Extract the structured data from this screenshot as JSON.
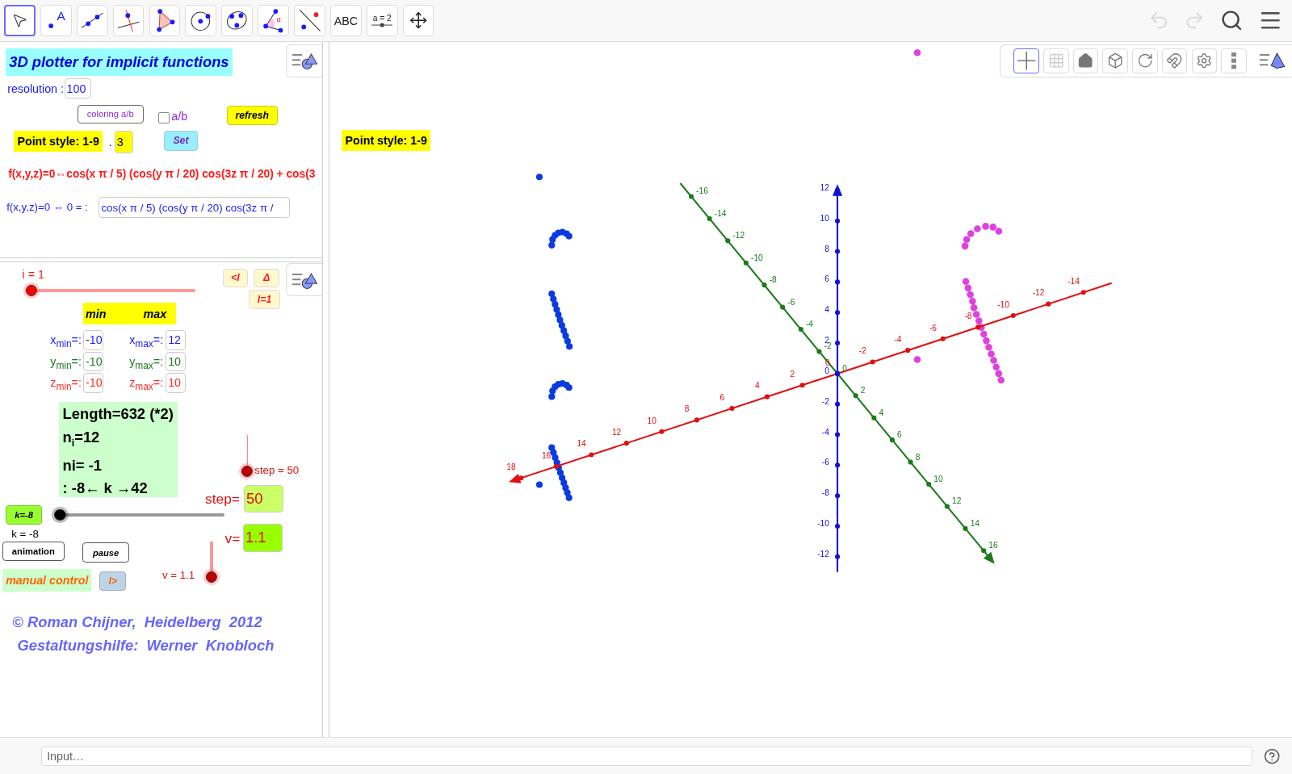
{
  "toolbar": {
    "tools": [
      {
        "kind": "move",
        "selected": true
      },
      {
        "kind": "point",
        "label": "A",
        "selected": false
      },
      {
        "kind": "line",
        "selected": false
      },
      {
        "kind": "perpendicular",
        "selected": false
      },
      {
        "kind": "polygon",
        "selected": false
      },
      {
        "kind": "circle",
        "selected": false
      },
      {
        "kind": "conic",
        "selected": false
      },
      {
        "kind": "angle",
        "label": "α",
        "selected": false
      },
      {
        "kind": "reflect",
        "selected": false
      },
      {
        "kind": "text",
        "label": "ABC",
        "selected": false
      },
      {
        "kind": "slider",
        "label": "a = 2",
        "selected": false
      },
      {
        "kind": "pan",
        "selected": false
      }
    ],
    "undo": {
      "disabled": true
    },
    "redo": {
      "disabled": true
    }
  },
  "algebra": {
    "title": "3D plotter for implicit functions",
    "resolution": {
      "label": "resolution :",
      "value": "100"
    },
    "coloring_button": "coloring a/b",
    "checkbox": {
      "label": "a/b",
      "checked": false
    },
    "refresh_button": "refresh",
    "point_style": {
      "label": "Point style: 1-9",
      "separator": ".",
      "value": "3"
    },
    "set_button": "Set",
    "formula": "f(x,y,z)=0⇔cos(x π / 5) (cos(y π / 20) cos(3z π / 20) + cos(3",
    "function_input": {
      "label": "f(x,y,z)=0 ⇔ 0 = :",
      "value": "cos(x π / 5) (cos(y π / 20) cos(3z π /"
    }
  },
  "controls": {
    "i_slider": {
      "label": "i = 1",
      "level": 0
    },
    "nav_buttons": [
      "<I",
      "Δ",
      "I=1"
    ],
    "range_header": {
      "min": "min",
      "max": "max"
    },
    "ranges": [
      {
        "min_label": "x$_{min}$=:",
        "min": "-10",
        "max_label": "x$_{max}$=:",
        "max": "12",
        "color": "#1a1aff"
      },
      {
        "min_label": "y$_{min}$=:",
        "min": "-10",
        "max_label": "y$_{max}$=:",
        "max": "10",
        "color": "#1a7a1a"
      },
      {
        "min_label": "z$_{min}$=:",
        "min": "-10",
        "max_label": "z$_{max}$=:",
        "max": "10",
        "color": "#ff2a2a"
      }
    ],
    "info": [
      "Length=632 (*2)",
      "n$_{i}$=12",
      "ni= -1",
      ": -8← k →42"
    ],
    "step_slider": {
      "label": "step = 50",
      "level": 0
    },
    "step_input": {
      "label": "step=",
      "value": "50"
    },
    "k_button": "k=-8",
    "k_slider": {
      "label": "k = -8",
      "level": 0
    },
    "animation_button": "animation",
    "pause_button": "pause",
    "v_slider": {
      "label": "v = 1.1",
      "level": 0.15
    },
    "v_input": {
      "label": "v=",
      "value": "1.1"
    },
    "manual_control": "manual control",
    "play_button": "I>",
    "credits": [
      "© Roman Chijner,  Heidelberg  2012",
      "Gestaltungshilfe:  Werner  Knobloch"
    ]
  },
  "graphics": {
    "point_style_label": "Point style: 1-9",
    "style_bar": [
      {
        "kind": "axes",
        "selected": true
      },
      {
        "kind": "grid",
        "selected": false
      },
      {
        "kind": "home",
        "selected": false
      },
      {
        "kind": "cube",
        "selected": false
      },
      {
        "kind": "rotate",
        "selected": false
      },
      {
        "kind": "magnet",
        "selected": false
      },
      {
        "kind": "gear",
        "selected": false
      },
      {
        "kind": "more",
        "selected": false
      }
    ],
    "x_axis": {
      "ticks": [
        "18",
        "16",
        "14",
        "12",
        "10",
        "8",
        "6",
        "4",
        "2",
        "0",
        "-2",
        "-4",
        "-6",
        "-8",
        "-10",
        "-12",
        "-14"
      ]
    },
    "y_axis": {
      "ticks": [
        "-16",
        "-14",
        "-12",
        "-10",
        "-8",
        "-6",
        "-4",
        "-2",
        "0",
        "2",
        "4",
        "6",
        "8",
        "10",
        "12",
        "14",
        "16"
      ]
    },
    "z_axis": {
      "ticks": [
        "12",
        "10",
        "8",
        "6",
        "4",
        "2",
        "0",
        "-2",
        "-4",
        "-6",
        "-8",
        "-10",
        "-12"
      ]
    }
  },
  "input_bar": {
    "placeholder": "Input…"
  }
}
